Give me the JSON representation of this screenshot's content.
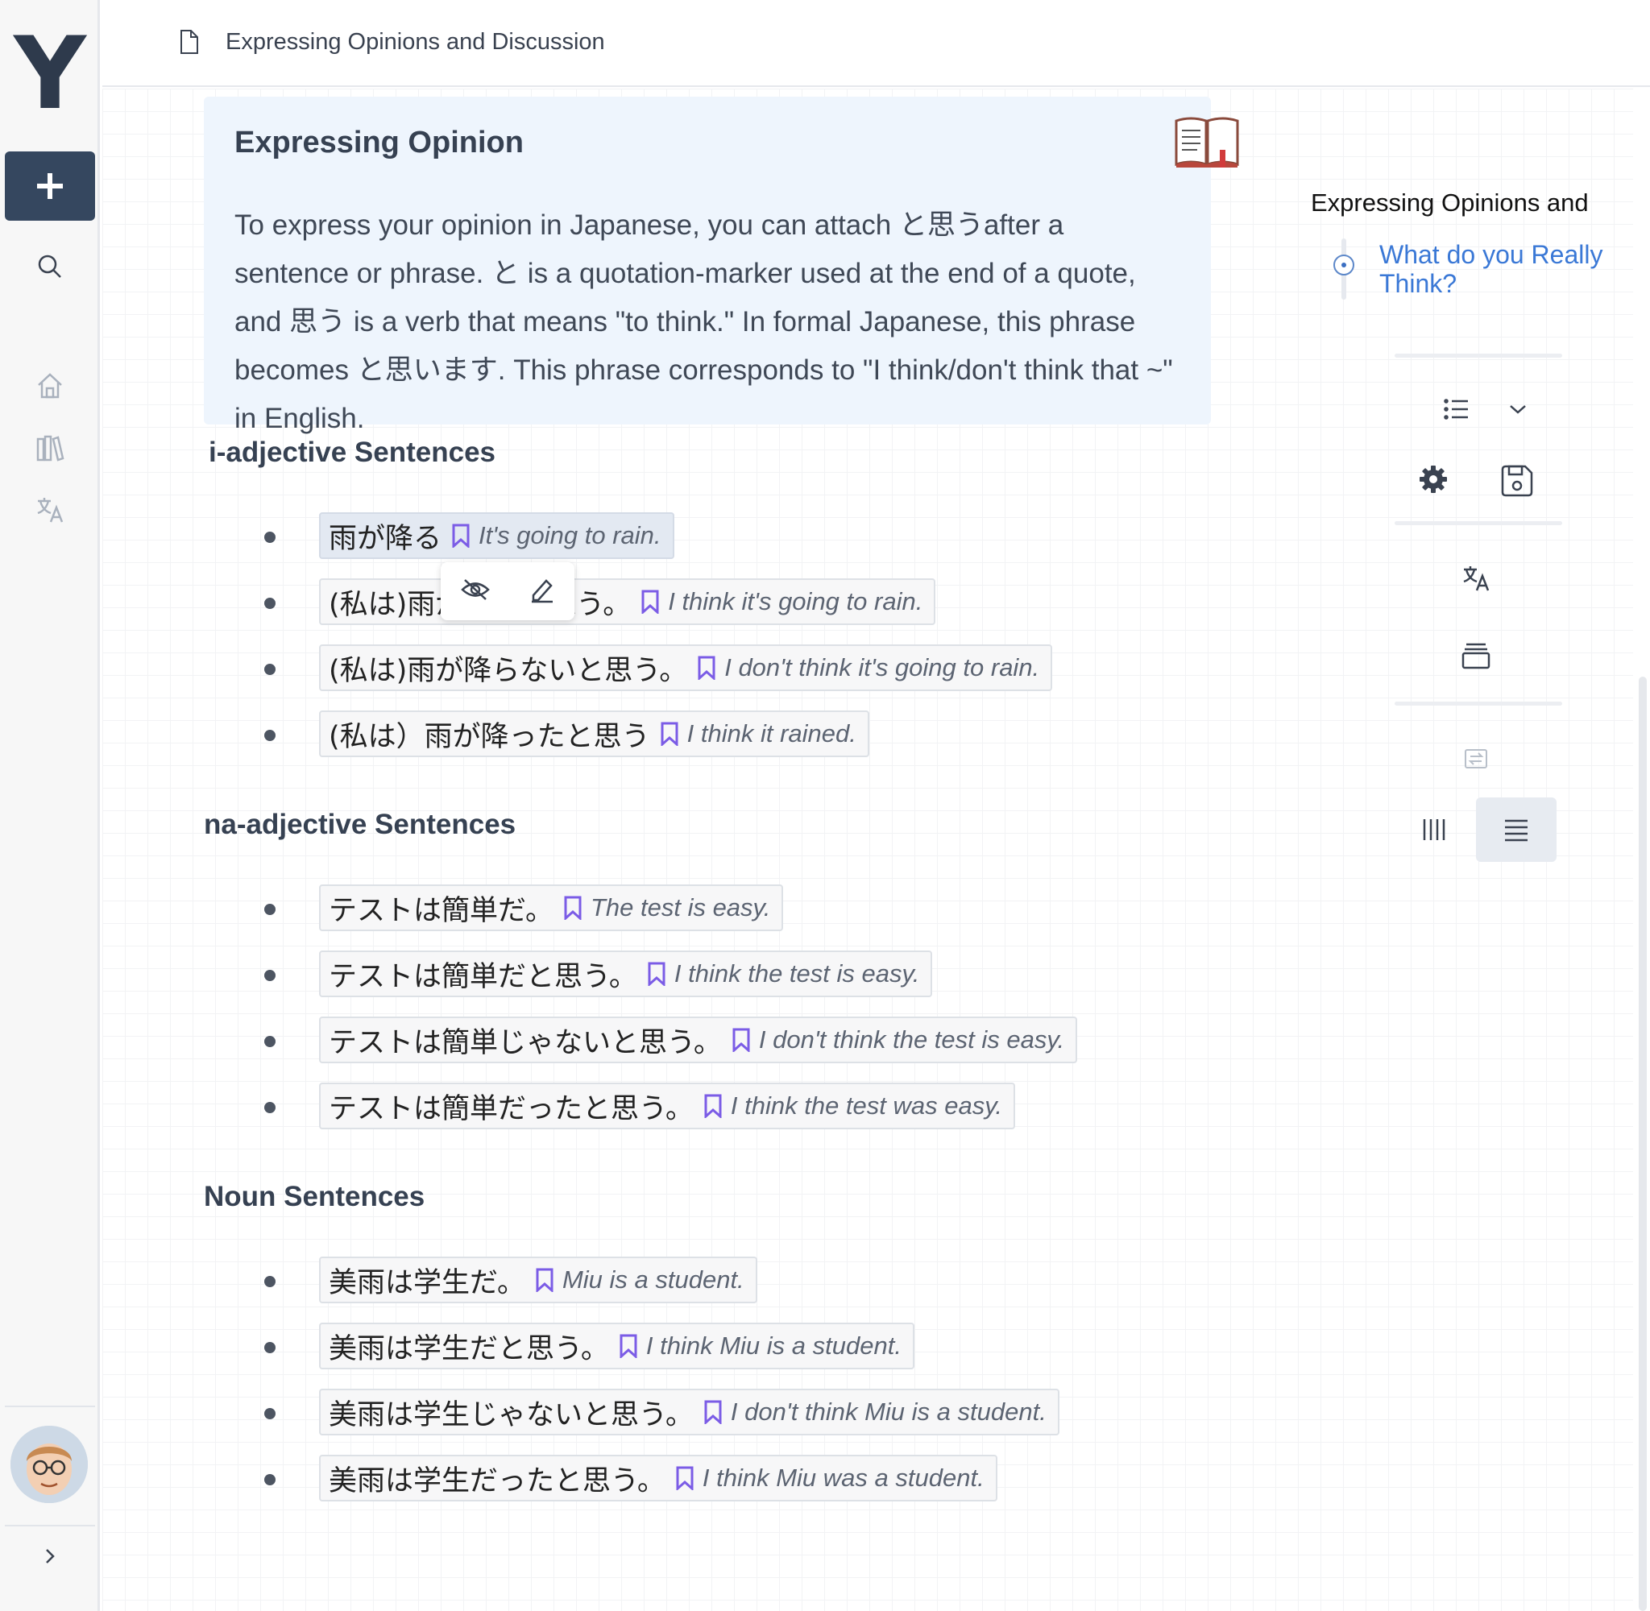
{
  "app": {
    "logo_letter": "Y"
  },
  "header": {
    "title": "Expressing Opinions and Discussion"
  },
  "callout": {
    "title": "Expressing Opinion",
    "body": "To express your opinion in Japanese, you can attach と思うafter a sentence or phrase. と is a quotation-marker used at the end of a quote, and 思う is a verb that means \"to think.\" In formal Japanese, this phrase becomes と思います. This phrase corresponds to \"I think/don't think that ~\" in English."
  },
  "sections": [
    {
      "heading": "i-adjective Sentences",
      "items": [
        {
          "jp": "雨が降る",
          "en": "It's going to rain."
        },
        {
          "jp": "(私は)雨が降ると思う。",
          "en": "I think it's going to rain."
        },
        {
          "jp": "(私は)雨が降らないと思う。",
          "en": "I don't think it's going to rain."
        },
        {
          "jp": "(私は）雨が降ったと思う",
          "en": "I think it rained."
        }
      ]
    },
    {
      "heading": "na-adjective Sentences",
      "items": [
        {
          "jp": "テストは簡単だ。",
          "en": "The test is easy."
        },
        {
          "jp": "テストは簡単だと思う。",
          "en": "I think the test is easy."
        },
        {
          "jp": "テストは簡単じゃないと思う。",
          "en": "I don't think the test is easy."
        },
        {
          "jp": "テストは簡単だったと思う。",
          "en": "I think the test was easy."
        }
      ]
    },
    {
      "heading": "Noun Sentences",
      "items": [
        {
          "jp": "美雨は学生だ。",
          "en": "Miu is a student."
        },
        {
          "jp": "美雨は学生だと思う。",
          "en": "I think Miu is a student."
        },
        {
          "jp": "美雨は学生じゃないと思う。",
          "en": "I don't think Miu is a student."
        },
        {
          "jp": "美雨は学生だったと思う。",
          "en": "I think Miu was a student."
        }
      ]
    }
  ],
  "toc": {
    "title": "Expressing Opinions and",
    "items": [
      {
        "label": "What do you Really Think?"
      }
    ]
  },
  "icons": {
    "sidebar": [
      "plus-icon",
      "search-icon",
      "home-icon",
      "library-icon",
      "translate-icon",
      "avatar",
      "chevron-right-icon"
    ],
    "right_panel": [
      "list-icon",
      "chevron-down-icon",
      "gear-icon",
      "save-icon",
      "translate-icon",
      "cards-icon",
      "swap-icon",
      "columns-icon",
      "rows-icon"
    ],
    "float_toolbar": [
      "eye-off-icon",
      "pencil-icon"
    ],
    "bookmark": "bookmark-icon",
    "book": "open-book-icon"
  },
  "colors": {
    "accent_dark": "#35475f",
    "bookmark": "#7b5ce6",
    "link": "#3a78d6",
    "callout_bg": "#eef5fd"
  }
}
